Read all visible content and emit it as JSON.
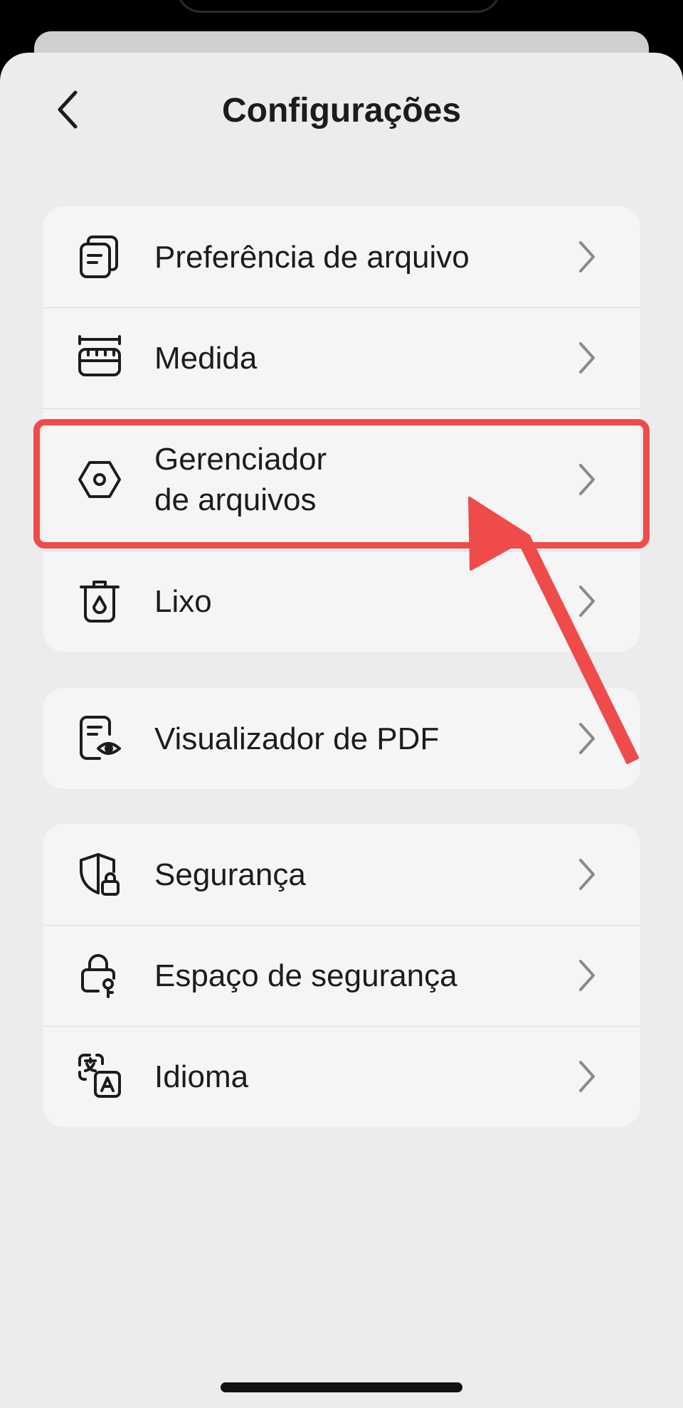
{
  "header": {
    "title": "Configurações",
    "back_icon": "chevron-left-icon"
  },
  "groups": [
    {
      "items": [
        {
          "label": "Preferência de arquivo",
          "icon": "file-stack-icon"
        },
        {
          "label": "Medida",
          "icon": "ruler-icon"
        },
        {
          "label": "Gerenciador\nde arquivos",
          "icon": "hexagon-gear-icon",
          "highlighted": true
        },
        {
          "label": "Lixo",
          "icon": "trash-icon"
        }
      ]
    },
    {
      "items": [
        {
          "label": "Visualizador de PDF",
          "icon": "document-eye-icon"
        }
      ]
    },
    {
      "items": [
        {
          "label": "Segurança",
          "icon": "shield-lock-icon"
        },
        {
          "label": "Espaço de segurança",
          "icon": "lock-key-icon"
        },
        {
          "label": "Idioma",
          "icon": "translate-icon"
        }
      ]
    }
  ],
  "colors": {
    "background": "#ececed",
    "card": "#f6f5f6",
    "text": "#1c1c1e",
    "annotation": "#ef4b4b"
  }
}
